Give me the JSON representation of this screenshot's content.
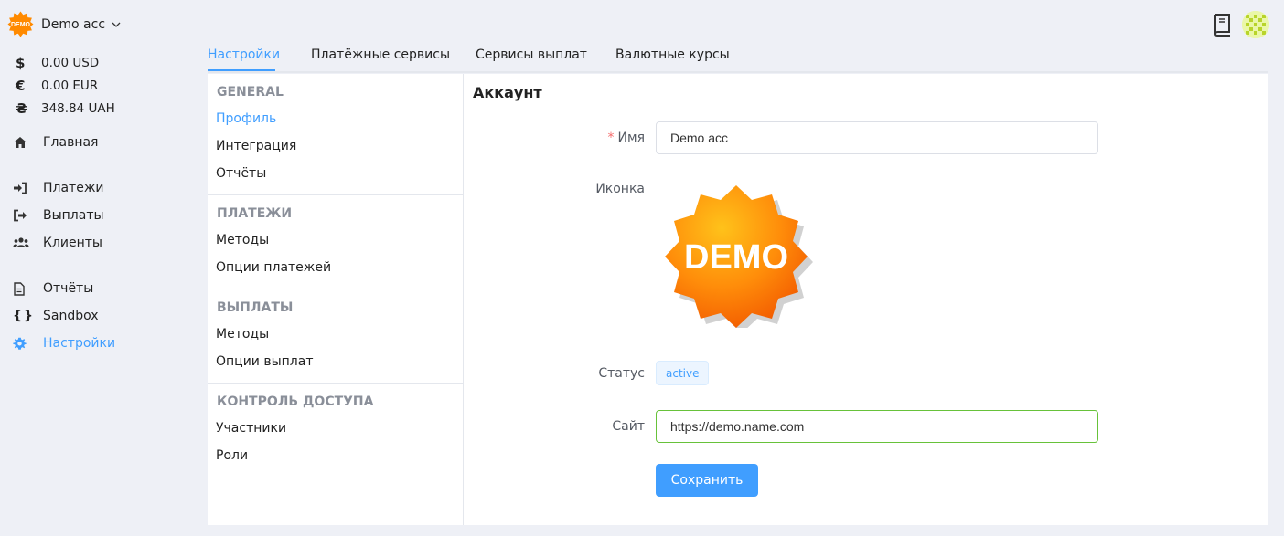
{
  "account": {
    "name": "Demo acc",
    "logo_text": "DEMO"
  },
  "balances": [
    {
      "symbol": "$",
      "value": "0.00 USD"
    },
    {
      "symbol": "€",
      "value": "0.00 EUR"
    },
    {
      "symbol": "₴",
      "value": "348.84 UAH"
    }
  ],
  "nav": {
    "home": "Главная",
    "payments": "Платежи",
    "payouts": "Выплаты",
    "clients": "Клиенты",
    "reports": "Отчёты",
    "sandbox": "Sandbox",
    "settings": "Настройки"
  },
  "tabs": [
    "Настройки",
    "Платёжные сервисы",
    "Сервисы выплат",
    "Валютные курсы"
  ],
  "menu": {
    "groups": [
      {
        "title": "GENERAL",
        "items": [
          "Профиль",
          "Интеграция",
          "Отчёты"
        ]
      },
      {
        "title": "ПЛАТЕЖИ",
        "items": [
          "Методы",
          "Опции платежей"
        ]
      },
      {
        "title": "ВЫПЛАТЫ",
        "items": [
          "Методы",
          "Опции выплат"
        ]
      },
      {
        "title": "КОНТРОЛЬ ДОСТУПА",
        "items": [
          "Участники",
          "Роли"
        ]
      }
    ]
  },
  "form": {
    "title": "Аккаунт",
    "name_label": "Имя",
    "name_value": "Demo acc",
    "icon_label": "Иконка",
    "icon_text": "DEMO",
    "status_label": "Статус",
    "status_value": "active",
    "site_label": "Сайт",
    "site_value": "https://demo.name.com",
    "save_label": "Сохранить"
  },
  "colors": {
    "accent": "#409eff",
    "success": "#67c23a",
    "required": "#f56c6c",
    "badge_orange": "#ff8a00"
  }
}
